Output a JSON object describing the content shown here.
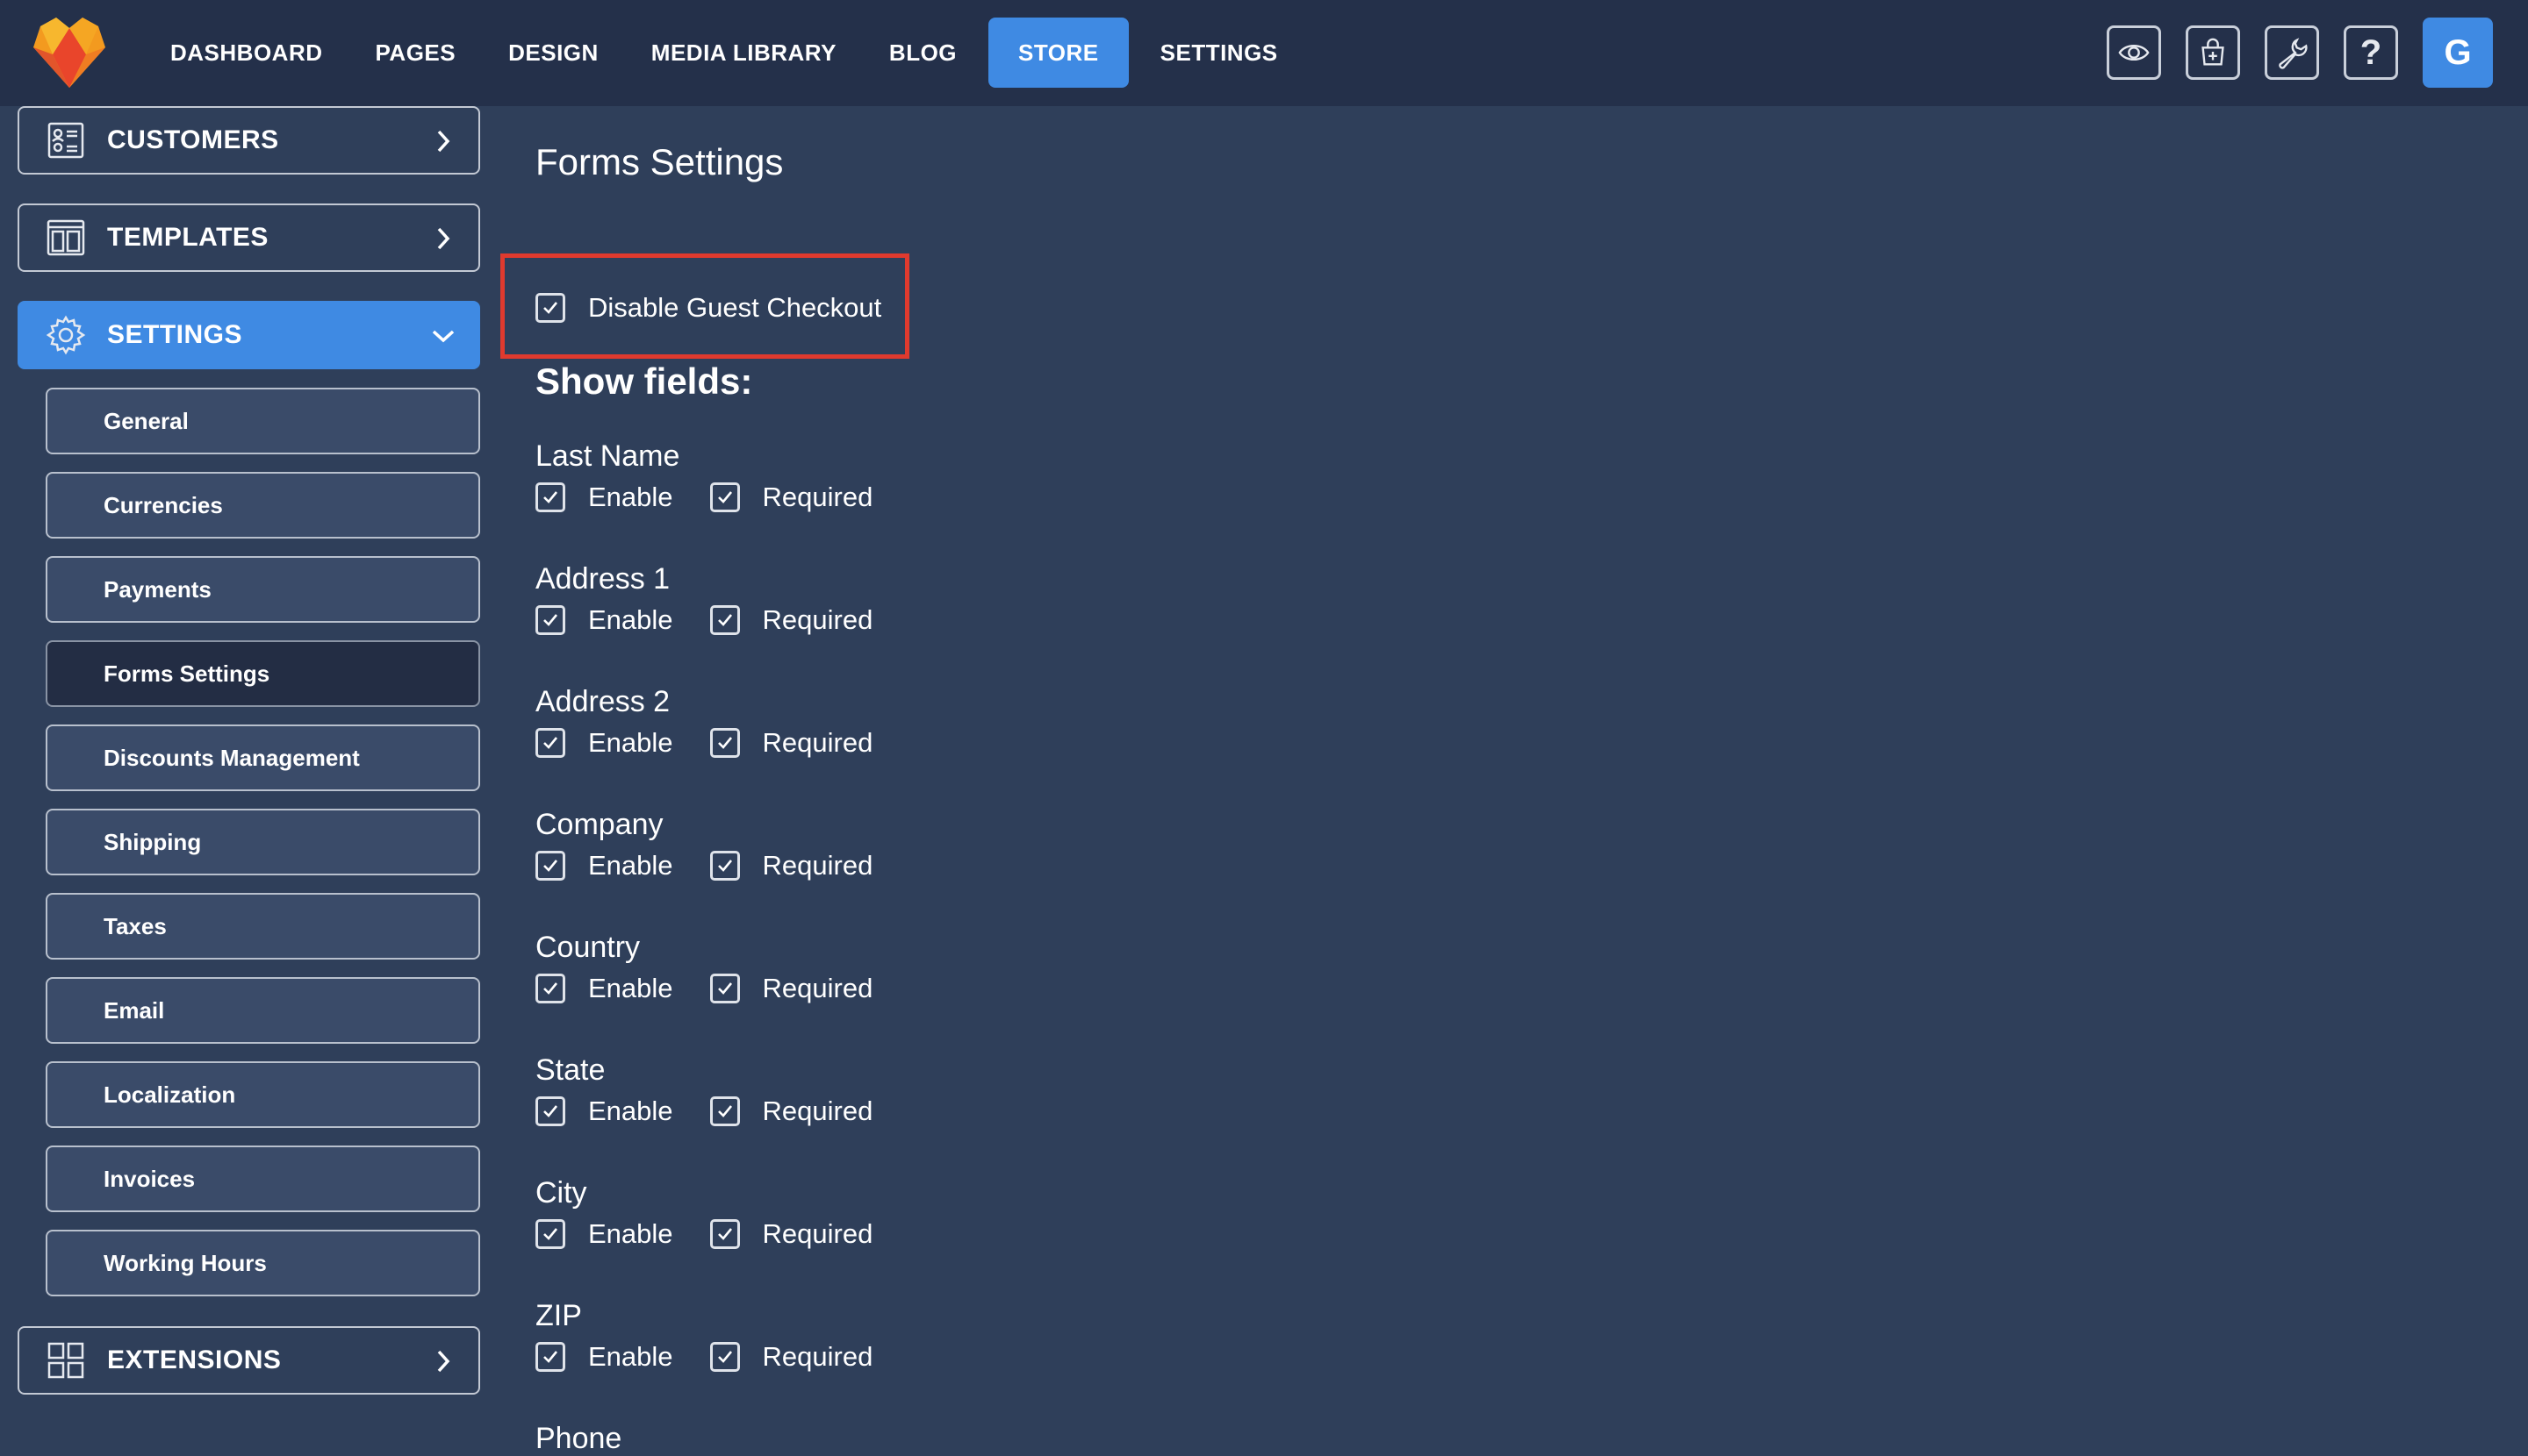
{
  "nav": {
    "items": [
      "DASHBOARD",
      "PAGES",
      "DESIGN",
      "MEDIA LIBRARY",
      "BLOG",
      "STORE",
      "SETTINGS"
    ],
    "active": "STORE"
  },
  "toolbar": {
    "icons": [
      "eye-icon",
      "cart-add-icon",
      "wrench-icon",
      "help-icon"
    ],
    "help_glyph": "?",
    "avatar_letter": "G"
  },
  "sidebar": {
    "customers_label": "CUSTOMERS",
    "templates_label": "TEMPLATES",
    "settings_label": "SETTINGS",
    "extensions_label": "EXTENSIONS",
    "sub_items": [
      "General",
      "Currencies",
      "Payments",
      "Forms Settings",
      "Discounts Management",
      "Shipping",
      "Taxes",
      "Email",
      "Localization",
      "Invoices",
      "Working Hours"
    ],
    "current": "Forms Settings"
  },
  "main": {
    "title": "Forms Settings",
    "guest_checkout_label": "Disable Guest Checkout",
    "guest_checkout_checked": true,
    "show_fields_label": "Show fields:",
    "enable_label": "Enable",
    "required_label": "Required",
    "fields": [
      {
        "name": "Last Name",
        "enable": true,
        "required": true
      },
      {
        "name": "Address 1",
        "enable": true,
        "required": true
      },
      {
        "name": "Address 2",
        "enable": true,
        "required": true
      },
      {
        "name": "Company",
        "enable": true,
        "required": true
      },
      {
        "name": "Country",
        "enable": true,
        "required": true
      },
      {
        "name": "State",
        "enable": true,
        "required": true
      },
      {
        "name": "City",
        "enable": true,
        "required": true
      },
      {
        "name": "ZIP",
        "enable": true,
        "required": true
      },
      {
        "name": "Phone"
      }
    ]
  },
  "colors": {
    "accent": "#3f8ae3",
    "topbar": "#24304a",
    "background": "#2f3f5a",
    "highlight": "#e03a2e"
  }
}
